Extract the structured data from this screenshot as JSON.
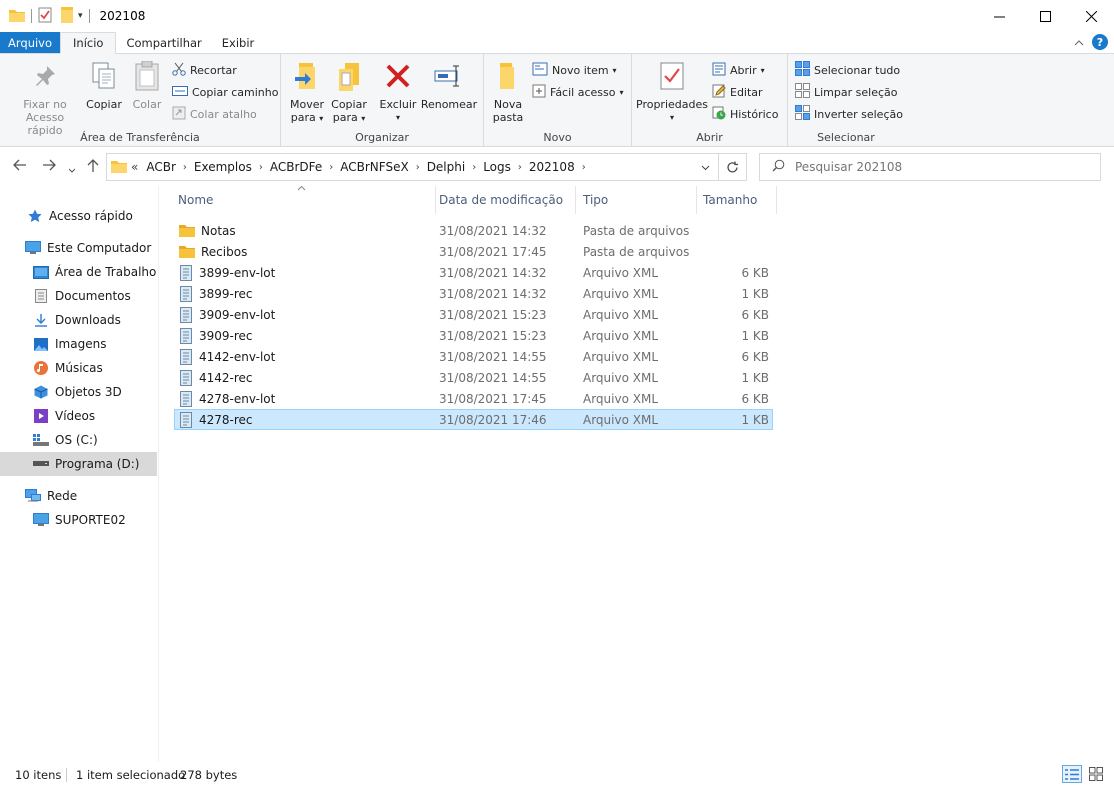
{
  "window": {
    "title": "202108",
    "minimize": "—",
    "maximize": "☐",
    "close": "✕"
  },
  "ribbon_tabs": {
    "file": "Arquivo",
    "home": "Início",
    "share": "Compartilhar",
    "view": "Exibir",
    "collapse": "^",
    "help": "?"
  },
  "ribbon": {
    "clipboard": {
      "label": "Área de Transferência",
      "pin_line1": "Fixar no",
      "pin_line2": "Acesso rápido",
      "copy": "Copiar",
      "paste": "Colar",
      "cut": "Recortar",
      "copy_path": "Copiar caminho",
      "paste_shortcut": "Colar atalho"
    },
    "organize": {
      "label": "Organizar",
      "move_line1": "Mover",
      "move_line2": "para",
      "copyto_line1": "Copiar",
      "copyto_line2": "para",
      "delete": "Excluir",
      "rename": "Renomear"
    },
    "new": {
      "label": "Novo",
      "folder_line1": "Nova",
      "folder_line2": "pasta",
      "new_item": "Novo item",
      "easy_access": "Fácil acesso"
    },
    "open": {
      "label": "Abrir",
      "properties": "Propriedades",
      "open": "Abrir",
      "edit": "Editar",
      "history": "Histórico"
    },
    "select": {
      "label": "Selecionar",
      "select_all": "Selecionar tudo",
      "select_none": "Limpar seleção",
      "invert": "Inverter seleção"
    }
  },
  "address": {
    "overflow": "«",
    "crumbs": [
      "ACBr",
      "Exemplos",
      "ACBrDFe",
      "ACBrNFSeX",
      "Delphi",
      "Logs",
      "202108"
    ],
    "search_placeholder": "Pesquisar 202108"
  },
  "nav_pane": {
    "items": [
      {
        "label": "Acesso rápido",
        "icon": "star-icon"
      },
      {
        "label": "Este Computador",
        "icon": "computer-icon"
      },
      {
        "label": "Área de Trabalho",
        "icon": "desktop-icon"
      },
      {
        "label": "Documentos",
        "icon": "documents-icon"
      },
      {
        "label": "Downloads",
        "icon": "download-icon"
      },
      {
        "label": "Imagens",
        "icon": "pictures-icon"
      },
      {
        "label": "Músicas",
        "icon": "music-icon"
      },
      {
        "label": "Objetos 3D",
        "icon": "cube-icon"
      },
      {
        "label": "Vídeos",
        "icon": "videos-icon"
      },
      {
        "label": "OS (C:)",
        "icon": "drive-c-icon"
      },
      {
        "label": "Programa (D:)",
        "icon": "drive-d-icon"
      },
      {
        "label": "Rede",
        "icon": "network-icon"
      },
      {
        "label": "SUPORTE02",
        "icon": "computer-icon"
      }
    ]
  },
  "columns": {
    "name": "Nome",
    "date": "Data de modificação",
    "type": "Tipo",
    "size": "Tamanho"
  },
  "files": [
    {
      "name": "Notas",
      "date": "31/08/2021 14:32",
      "type": "Pasta de arquivos",
      "size": "",
      "kind": "folder"
    },
    {
      "name": "Recibos",
      "date": "31/08/2021 17:45",
      "type": "Pasta de arquivos",
      "size": "",
      "kind": "folder"
    },
    {
      "name": "3899-env-lot",
      "date": "31/08/2021 14:32",
      "type": "Arquivo XML",
      "size": "6 KB",
      "kind": "xml"
    },
    {
      "name": "3899-rec",
      "date": "31/08/2021 14:32",
      "type": "Arquivo XML",
      "size": "1 KB",
      "kind": "xml"
    },
    {
      "name": "3909-env-lot",
      "date": "31/08/2021 15:23",
      "type": "Arquivo XML",
      "size": "6 KB",
      "kind": "xml"
    },
    {
      "name": "3909-rec",
      "date": "31/08/2021 15:23",
      "type": "Arquivo XML",
      "size": "1 KB",
      "kind": "xml"
    },
    {
      "name": "4142-env-lot",
      "date": "31/08/2021 14:55",
      "type": "Arquivo XML",
      "size": "6 KB",
      "kind": "xml"
    },
    {
      "name": "4142-rec",
      "date": "31/08/2021 14:55",
      "type": "Arquivo XML",
      "size": "1 KB",
      "kind": "xml"
    },
    {
      "name": "4278-env-lot",
      "date": "31/08/2021 17:45",
      "type": "Arquivo XML",
      "size": "6 KB",
      "kind": "xml"
    },
    {
      "name": "4278-rec",
      "date": "31/08/2021 17:46",
      "type": "Arquivo XML",
      "size": "1 KB",
      "kind": "xml",
      "selected": true
    }
  ],
  "status": {
    "count": "10 itens",
    "selected": "1 item selecionado",
    "size": "278 bytes"
  },
  "colors": {
    "accent": "#1979ca",
    "selection": "#cce8ff",
    "folder": "#f8c33c"
  }
}
